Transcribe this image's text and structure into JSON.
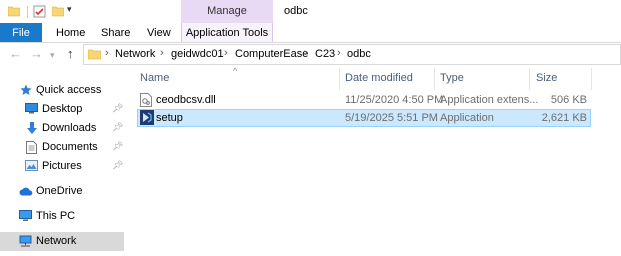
{
  "window": {
    "title": "odbc",
    "context_tab_group": "Manage",
    "context_tab": "Application Tools"
  },
  "ribbon": {
    "tabs": [
      "File",
      "Home",
      "Share",
      "View"
    ]
  },
  "address": {
    "breadcrumbs": [
      "Network",
      "geidwdc01",
      "ComputerEase",
      "C23",
      "odbc"
    ]
  },
  "nav_pane": {
    "items": [
      {
        "label": "Quick access",
        "icon": "star-icon"
      },
      {
        "label": "Desktop",
        "icon": "desktop-icon",
        "pinned": true
      },
      {
        "label": "Downloads",
        "icon": "download-arrow-icon",
        "pinned": true
      },
      {
        "label": "Documents",
        "icon": "documents-icon",
        "pinned": true
      },
      {
        "label": "Pictures",
        "icon": "pictures-icon",
        "pinned": true
      },
      {
        "label": "OneDrive",
        "icon": "cloud-icon"
      },
      {
        "label": "This PC",
        "icon": "monitor-icon"
      },
      {
        "label": "Network",
        "icon": "network-icon"
      }
    ]
  },
  "columns": {
    "name": "Name",
    "date": "Date modified",
    "type": "Type",
    "size": "Size"
  },
  "files": [
    {
      "name": "ceodbcsv.dll",
      "date": "11/25/2020 4:50 PM",
      "type": "Application extens...",
      "size": "506 KB",
      "icon": "dll-file-icon"
    },
    {
      "name": "setup",
      "date": "5/19/2025 5:51 PM",
      "type": "Application",
      "size": "2,621 KB",
      "icon": "application-icon"
    }
  ],
  "colors": {
    "file_tab": "#1979ca",
    "context_tab": "#e8d9f5",
    "selection": "#cce8ff",
    "selection_border": "#99d1ff"
  }
}
